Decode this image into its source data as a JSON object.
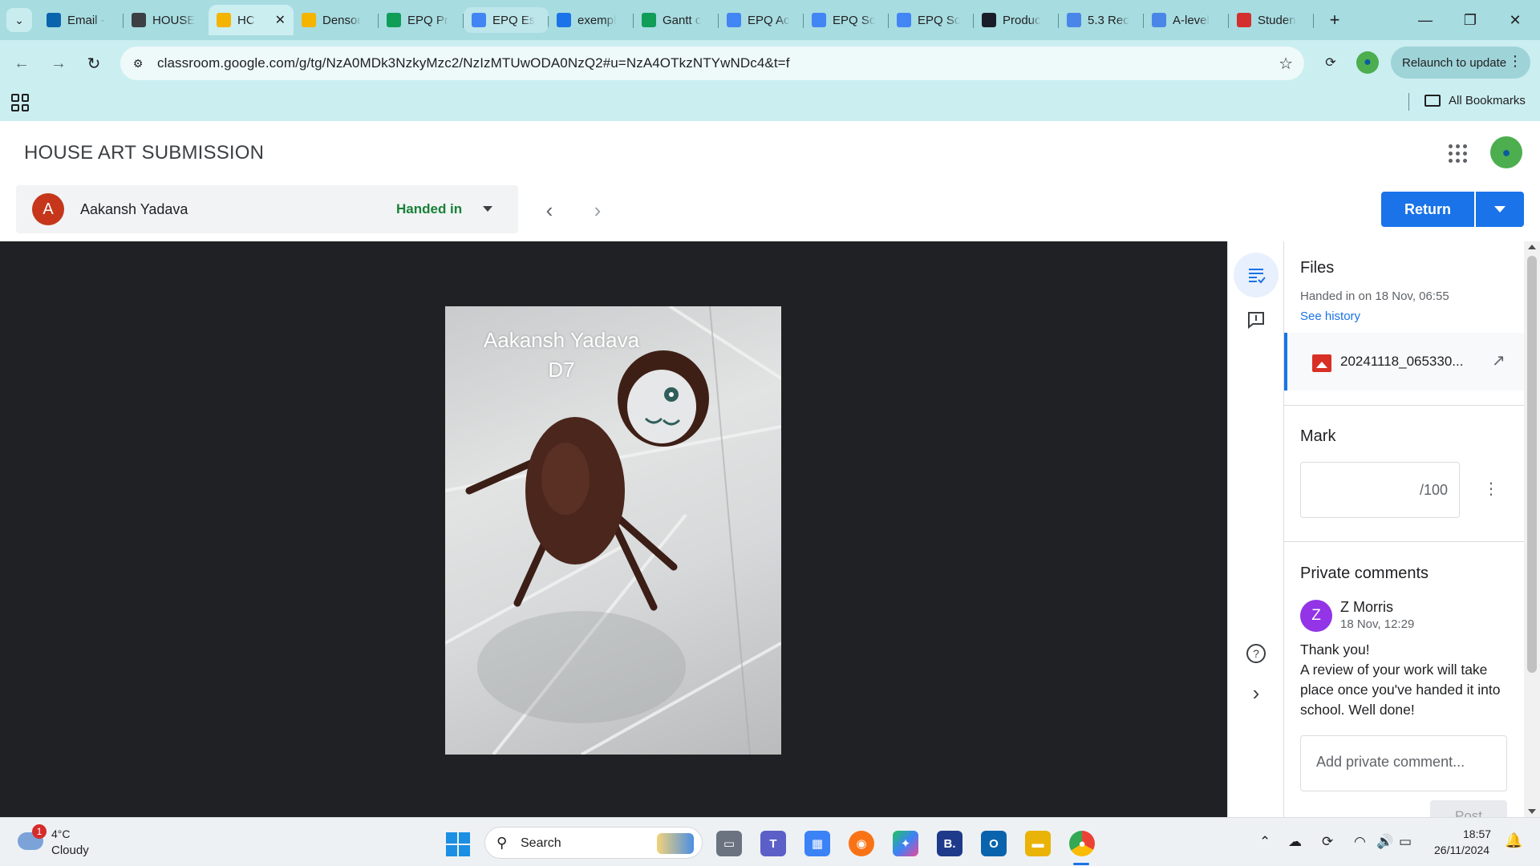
{
  "browser": {
    "tabs": [
      {
        "title": "Email -",
        "favicon": "outlook-icon",
        "color": "#0a64ad"
      },
      {
        "title": "HOUSE",
        "favicon": "classroom-dark-icon",
        "color": "#3c4043"
      },
      {
        "title": "HC",
        "favicon": "classroom-icon",
        "color": "#f4b400",
        "active": true,
        "close": "✕"
      },
      {
        "title": "Densor",
        "favicon": "slides-icon",
        "color": "#f4b400"
      },
      {
        "title": "EPQ Pr",
        "favicon": "sheets-icon",
        "color": "#0f9d58"
      },
      {
        "title": "EPQ Es",
        "favicon": "docs-icon",
        "color": "#4285f4"
      },
      {
        "title": "exempl",
        "favicon": "pinterest-icon",
        "color": "#1a73e8"
      },
      {
        "title": "Gantt c",
        "favicon": "sheets-icon",
        "color": "#0f9d58"
      },
      {
        "title": "EPQ Ac",
        "favicon": "docs-icon",
        "color": "#4285f4"
      },
      {
        "title": "EPQ Sc",
        "favicon": "docs-icon",
        "color": "#4285f4"
      },
      {
        "title": "EPQ Sc",
        "favicon": "docs-icon",
        "color": "#4285f4"
      },
      {
        "title": "Produc",
        "favicon": "quizlet-icon",
        "color": "#1a1d28"
      },
      {
        "title": "5.3 Rec",
        "favicon": "wordpress-icon",
        "color": "#4a86e8"
      },
      {
        "title": "A-level",
        "favicon": "wordpress-icon",
        "color": "#4a86e8"
      },
      {
        "title": "Studen",
        "favicon": "app-icon",
        "color": "#d32f2f"
      }
    ],
    "url": "classroom.google.com/g/tg/NzA0MDk3NzkyMzc2/NzIzMTUwODA0NzQ2#u=NzA4OTkzNTYwNDc4&t=f",
    "relaunch_label": "Relaunch to update",
    "all_bookmarks": "All Bookmarks"
  },
  "page": {
    "title": "HOUSE ART SUBMISSION",
    "student": {
      "initial": "A",
      "name": "Aakansh Yadava",
      "status": "Handed in"
    },
    "return_label": "Return",
    "photo_caption_line1": "Aakansh Yadava",
    "photo_caption_line2": "D7"
  },
  "panel": {
    "files_title": "Files",
    "handed_in_text": "Handed in on 18 Nov, 06:55",
    "see_history": "See history",
    "file_name": "20241118_065330...",
    "mark_title": "Mark",
    "mark_suffix": "/100",
    "comments_title": "Private comments",
    "comment": {
      "initial": "Z",
      "author": "Z Morris",
      "time": "18 Nov, 12:29",
      "line1": "Thank you!",
      "line2": "A review of your work will take place once you've handed it into school. Well done!"
    },
    "comment_placeholder": "Add private comment...",
    "post_label": "Post"
  },
  "taskbar": {
    "weather_badge": "1",
    "temperature": "4°C",
    "condition": "Cloudy",
    "search_label": "Search",
    "time": "18:57",
    "date": "26/11/2024"
  }
}
